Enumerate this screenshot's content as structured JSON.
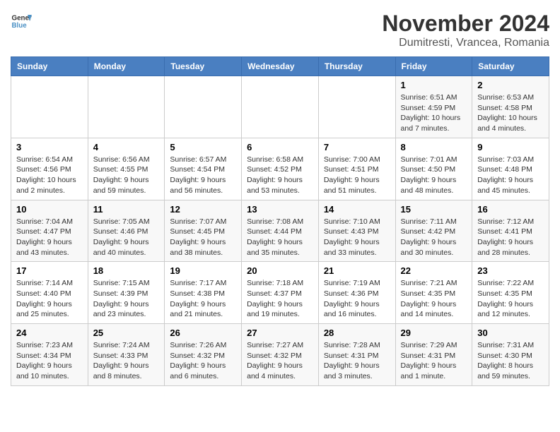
{
  "header": {
    "logo_line1": "General",
    "logo_line2": "Blue",
    "month": "November 2024",
    "location": "Dumitresti, Vrancea, Romania"
  },
  "days_of_week": [
    "Sunday",
    "Monday",
    "Tuesday",
    "Wednesday",
    "Thursday",
    "Friday",
    "Saturday"
  ],
  "weeks": [
    [
      {
        "day": "",
        "info": ""
      },
      {
        "day": "",
        "info": ""
      },
      {
        "day": "",
        "info": ""
      },
      {
        "day": "",
        "info": ""
      },
      {
        "day": "",
        "info": ""
      },
      {
        "day": "1",
        "info": "Sunrise: 6:51 AM\nSunset: 4:59 PM\nDaylight: 10 hours and 7 minutes."
      },
      {
        "day": "2",
        "info": "Sunrise: 6:53 AM\nSunset: 4:58 PM\nDaylight: 10 hours and 4 minutes."
      }
    ],
    [
      {
        "day": "3",
        "info": "Sunrise: 6:54 AM\nSunset: 4:56 PM\nDaylight: 10 hours and 2 minutes."
      },
      {
        "day": "4",
        "info": "Sunrise: 6:56 AM\nSunset: 4:55 PM\nDaylight: 9 hours and 59 minutes."
      },
      {
        "day": "5",
        "info": "Sunrise: 6:57 AM\nSunset: 4:54 PM\nDaylight: 9 hours and 56 minutes."
      },
      {
        "day": "6",
        "info": "Sunrise: 6:58 AM\nSunset: 4:52 PM\nDaylight: 9 hours and 53 minutes."
      },
      {
        "day": "7",
        "info": "Sunrise: 7:00 AM\nSunset: 4:51 PM\nDaylight: 9 hours and 51 minutes."
      },
      {
        "day": "8",
        "info": "Sunrise: 7:01 AM\nSunset: 4:50 PM\nDaylight: 9 hours and 48 minutes."
      },
      {
        "day": "9",
        "info": "Sunrise: 7:03 AM\nSunset: 4:48 PM\nDaylight: 9 hours and 45 minutes."
      }
    ],
    [
      {
        "day": "10",
        "info": "Sunrise: 7:04 AM\nSunset: 4:47 PM\nDaylight: 9 hours and 43 minutes."
      },
      {
        "day": "11",
        "info": "Sunrise: 7:05 AM\nSunset: 4:46 PM\nDaylight: 9 hours and 40 minutes."
      },
      {
        "day": "12",
        "info": "Sunrise: 7:07 AM\nSunset: 4:45 PM\nDaylight: 9 hours and 38 minutes."
      },
      {
        "day": "13",
        "info": "Sunrise: 7:08 AM\nSunset: 4:44 PM\nDaylight: 9 hours and 35 minutes."
      },
      {
        "day": "14",
        "info": "Sunrise: 7:10 AM\nSunset: 4:43 PM\nDaylight: 9 hours and 33 minutes."
      },
      {
        "day": "15",
        "info": "Sunrise: 7:11 AM\nSunset: 4:42 PM\nDaylight: 9 hours and 30 minutes."
      },
      {
        "day": "16",
        "info": "Sunrise: 7:12 AM\nSunset: 4:41 PM\nDaylight: 9 hours and 28 minutes."
      }
    ],
    [
      {
        "day": "17",
        "info": "Sunrise: 7:14 AM\nSunset: 4:40 PM\nDaylight: 9 hours and 25 minutes."
      },
      {
        "day": "18",
        "info": "Sunrise: 7:15 AM\nSunset: 4:39 PM\nDaylight: 9 hours and 23 minutes."
      },
      {
        "day": "19",
        "info": "Sunrise: 7:17 AM\nSunset: 4:38 PM\nDaylight: 9 hours and 21 minutes."
      },
      {
        "day": "20",
        "info": "Sunrise: 7:18 AM\nSunset: 4:37 PM\nDaylight: 9 hours and 19 minutes."
      },
      {
        "day": "21",
        "info": "Sunrise: 7:19 AM\nSunset: 4:36 PM\nDaylight: 9 hours and 16 minutes."
      },
      {
        "day": "22",
        "info": "Sunrise: 7:21 AM\nSunset: 4:35 PM\nDaylight: 9 hours and 14 minutes."
      },
      {
        "day": "23",
        "info": "Sunrise: 7:22 AM\nSunset: 4:35 PM\nDaylight: 9 hours and 12 minutes."
      }
    ],
    [
      {
        "day": "24",
        "info": "Sunrise: 7:23 AM\nSunset: 4:34 PM\nDaylight: 9 hours and 10 minutes."
      },
      {
        "day": "25",
        "info": "Sunrise: 7:24 AM\nSunset: 4:33 PM\nDaylight: 9 hours and 8 minutes."
      },
      {
        "day": "26",
        "info": "Sunrise: 7:26 AM\nSunset: 4:32 PM\nDaylight: 9 hours and 6 minutes."
      },
      {
        "day": "27",
        "info": "Sunrise: 7:27 AM\nSunset: 4:32 PM\nDaylight: 9 hours and 4 minutes."
      },
      {
        "day": "28",
        "info": "Sunrise: 7:28 AM\nSunset: 4:31 PM\nDaylight: 9 hours and 3 minutes."
      },
      {
        "day": "29",
        "info": "Sunrise: 7:29 AM\nSunset: 4:31 PM\nDaylight: 9 hours and 1 minute."
      },
      {
        "day": "30",
        "info": "Sunrise: 7:31 AM\nSunset: 4:30 PM\nDaylight: 8 hours and 59 minutes."
      }
    ]
  ]
}
